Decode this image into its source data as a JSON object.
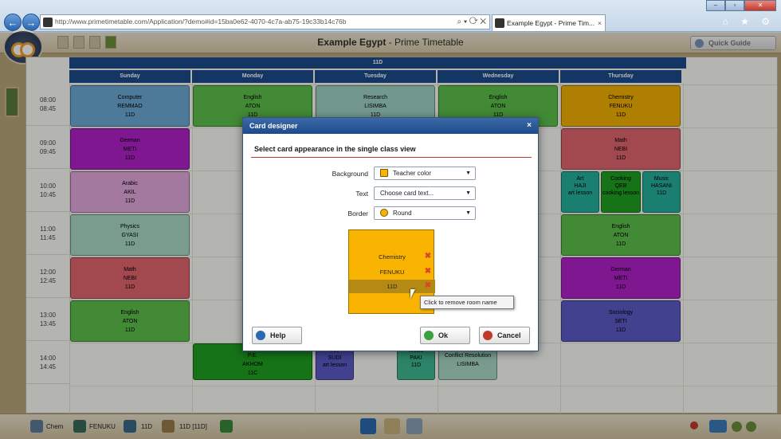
{
  "browser": {
    "url": "http://www.primetimetable.com/Application/?demo#id=15ba0e62-4070-4c7a-ab75-19c33b14c76b",
    "tab_title": "Example Egypt - Prime Tim...",
    "tab_close": "×",
    "addr_tools": "⌕ ▾ ⟳ ✕",
    "back_icon": "←",
    "forward_icon": "→",
    "icons": "⌂ ★ ⚙"
  },
  "app": {
    "title_bold": "Example Egypt",
    "title_rest": " - Prime Timetable",
    "quick_guide": "Quick Guide",
    "class_name": "11D",
    "days": [
      "Sunday",
      "Monday",
      "Tuesday",
      "Wednesday",
      "Thursday"
    ],
    "times": [
      {
        "start": "08:00",
        "end": "08:45"
      },
      {
        "start": "09:00",
        "end": "09:45"
      },
      {
        "start": "10:00",
        "end": "10:45"
      },
      {
        "start": "11:00",
        "end": "11:45"
      },
      {
        "start": "12:00",
        "end": "12:45"
      },
      {
        "start": "13:00",
        "end": "13:45"
      },
      {
        "start": "14:00",
        "end": "14:45"
      }
    ],
    "cards": [
      {
        "l1": "Computer",
        "l2": "REMMAO",
        "l3": "11D",
        "color": "#6da9d6"
      },
      {
        "l1": "English",
        "l2": "ATON",
        "l3": "11D",
        "color": "#5cbf4a"
      },
      {
        "l1": "Research",
        "l2": "LISIMBA",
        "l3": "11D",
        "color": "#9fd3c4"
      },
      {
        "l1": "English",
        "l2": "ATON",
        "l3": "11D",
        "color": "#5cbf4a"
      },
      {
        "l1": "Chemistry",
        "l2": "FENUKU",
        "l3": "11D",
        "color": "#f2b000"
      },
      {
        "l1": "German",
        "l2": "METI",
        "l3": "11D",
        "color": "#b021c8"
      },
      {
        "l1": "Math",
        "l2": "NEBI",
        "l3": "11D",
        "color": "#e0666e"
      },
      {
        "l1": "Arabic",
        "l2": "AKIL",
        "l3": "11D",
        "color": "#e3a8dd"
      },
      {
        "l1": "Physics",
        "l2": "GYASI",
        "l3": "11D",
        "color": "#a8d9c6"
      },
      {
        "l1": "English",
        "l2": "ATON",
        "l3": "11D",
        "color": "#5cbf4a"
      },
      {
        "l1": "Math",
        "l2": "NEBI",
        "l3": "11D",
        "color": "#e0666e"
      },
      {
        "l1": "German",
        "l2": "METI",
        "l3": "11D",
        "color": "#b021c8"
      },
      {
        "l1": "English",
        "l2": "ATON",
        "l3": "11D",
        "color": "#5cbf4a"
      },
      {
        "l1": "Sociology",
        "l2": "SETI",
        "l3": "11D",
        "color": "#5a5ac8"
      },
      {
        "l1": "Art",
        "l2": "HAJI",
        "l3": "art lesson",
        "color": "#25b09c"
      },
      {
        "l1": "Cooking",
        "l2": "QEB",
        "l3": "cooking lesson",
        "color": "#1fa020"
      },
      {
        "l1": "Music",
        "l2": "HASANI",
        "l3": "11D",
        "color": "#25b09c"
      },
      {
        "l1": "P.E.",
        "l2": "AKHOM",
        "l3": "11C",
        "color": "#1fa020"
      },
      {
        "l1": "Art",
        "l2": "SUDI",
        "l3": "art lesson",
        "color": "#5a5ac8"
      },
      {
        "l1": "Music",
        "l2": "PAKI",
        "l3": "11D",
        "color": "#3fb890"
      },
      {
        "l1": "Conflict Resolution",
        "l2": "LISIMBA",
        "l3": "",
        "color": "#a8d9c6"
      }
    ],
    "status": {
      "subject": "Chem",
      "teacher": "FENUKU",
      "class": "11D",
      "room": "11D [11D]"
    }
  },
  "dialog": {
    "title": "Card designer",
    "close": "×",
    "subtitle": "Select card appearance in the single class view",
    "background_label": "Background",
    "background_value": "Teacher color",
    "text_label": "Text",
    "text_value": "Choose card text...",
    "border_label": "Border",
    "border_value": "Round",
    "preview": [
      "Chemistry",
      "FENUKU",
      "11D"
    ],
    "preview_color": "#f8b400",
    "tooltip": "Click to remove room name",
    "help_label": "Help",
    "ok_label": "Ok",
    "cancel_label": "Cancel"
  }
}
